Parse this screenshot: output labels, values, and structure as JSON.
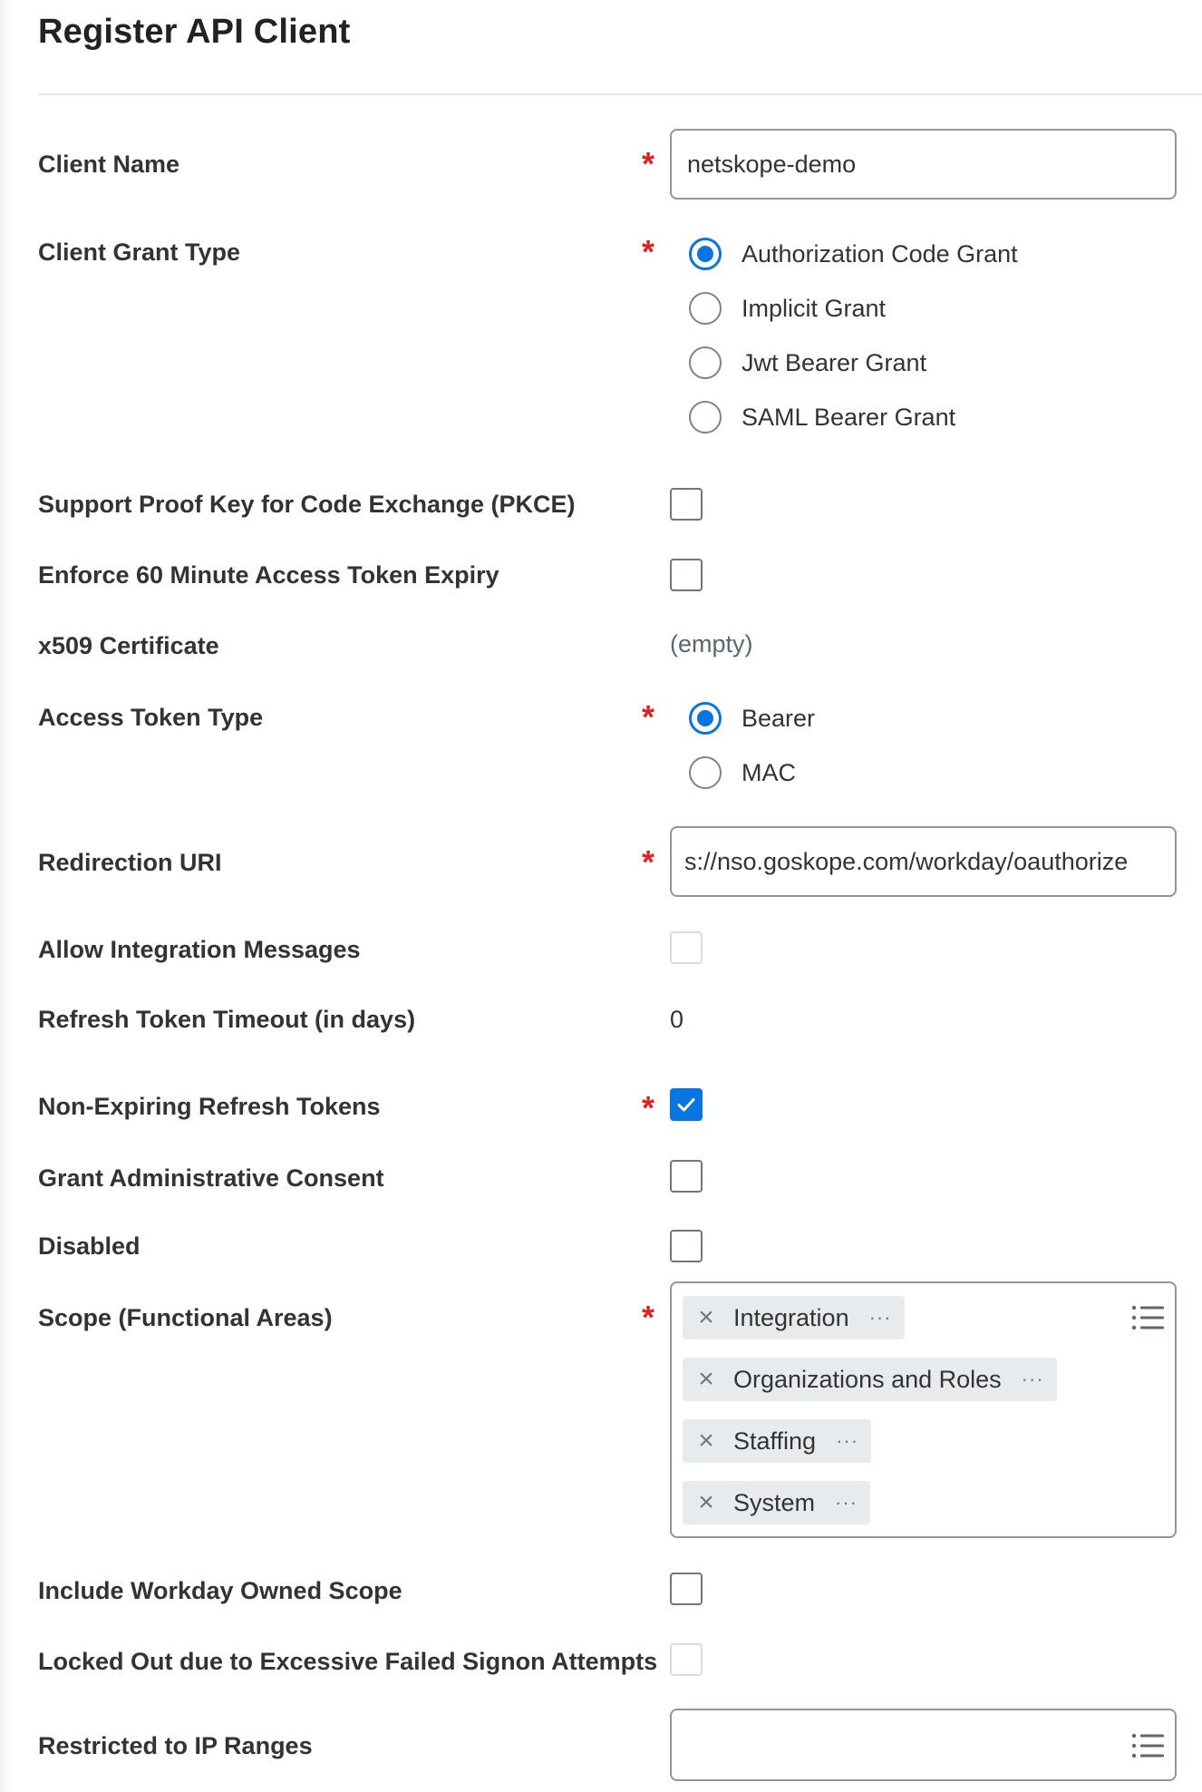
{
  "page": {
    "title": "Register API Client"
  },
  "fields": {
    "client_name": {
      "label": "Client Name",
      "required": "*",
      "value": "netskope-demo"
    },
    "client_grant_type": {
      "label": "Client Grant Type",
      "required": "*",
      "options": [
        "Authorization Code Grant",
        "Implicit Grant",
        "Jwt Bearer Grant",
        "SAML Bearer Grant"
      ],
      "selected": "Authorization Code Grant"
    },
    "pkce": {
      "label": "Support Proof Key for Code Exchange (PKCE)",
      "checked": false
    },
    "token_expiry": {
      "label": "Enforce 60 Minute Access Token Expiry",
      "checked": false
    },
    "x509": {
      "label": "x509 Certificate",
      "value": "(empty)"
    },
    "access_token_type": {
      "label": "Access Token Type",
      "required": "*",
      "options": [
        "Bearer",
        "MAC"
      ],
      "selected": "Bearer"
    },
    "redirection_uri": {
      "label": "Redirection URI",
      "required": "*",
      "value": "s://nso.goskope.com/workday/oauthorize"
    },
    "allow_integration_messages": {
      "label": "Allow Integration Messages",
      "checked": false
    },
    "refresh_token_timeout": {
      "label": "Refresh Token Timeout (in days)",
      "value": "0"
    },
    "non_expiring_refresh_tokens": {
      "label": "Non-Expiring Refresh Tokens",
      "required": "*",
      "checked": true
    },
    "grant_admin_consent": {
      "label": "Grant Administrative Consent",
      "checked": false
    },
    "disabled": {
      "label": "Disabled",
      "checked": false
    },
    "scope": {
      "label": "Scope (Functional Areas)",
      "required": "*",
      "items": [
        "Integration",
        "Organizations and Roles",
        "Staffing",
        "System"
      ],
      "remove_icon": "×",
      "more_icon": "···"
    },
    "include_workday_owned_scope": {
      "label": "Include Workday Owned Scope",
      "checked": false
    },
    "locked_out": {
      "label": "Locked Out due to Excessive Failed Signon Attempts",
      "checked": false
    },
    "restricted_ip_ranges": {
      "label": "Restricted to IP Ranges",
      "value": ""
    }
  },
  "colors": {
    "accent": "#0875e1",
    "required": "#de2121",
    "border": "#8e959c",
    "pill_bg": "#e8ebee"
  },
  "icons": {
    "list": "list-icon",
    "check": "checkmark-icon",
    "remove": "close-icon",
    "more": "ellipsis-icon"
  }
}
